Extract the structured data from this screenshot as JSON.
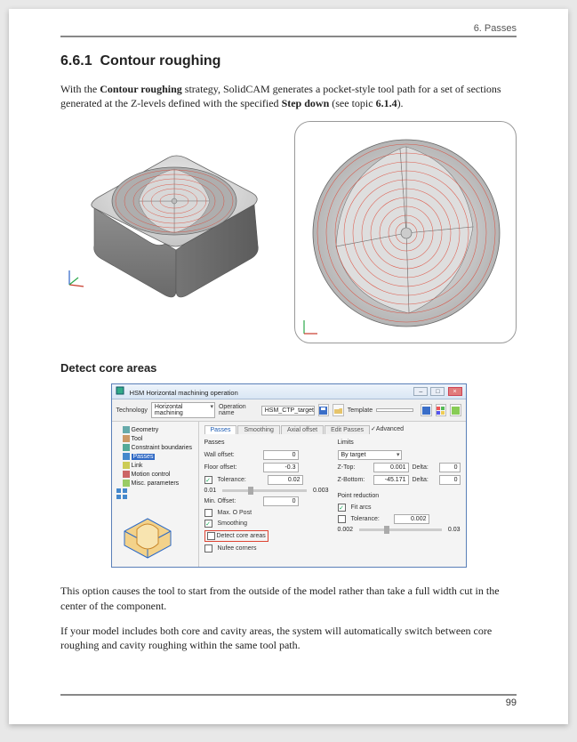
{
  "header": {
    "chapter": "6. Passes"
  },
  "section": {
    "number": "6.6.1",
    "title": "Contour roughing"
  },
  "intro": {
    "pre": "With the ",
    "bold1": "Contour roughing",
    "mid": " strategy, SolidCAM generates a pocket-style tool path for a set of sections generated at the Z-levels defined with the specified ",
    "bold2": "Step down",
    "post1": " (see topic ",
    "bold3": "6.1.4",
    "post2": ")."
  },
  "subheading": "Detect core areas",
  "dialog": {
    "title": "HSM Horizontal machining operation",
    "win_buttons": {
      "min": "–",
      "max": "□",
      "close": "×"
    },
    "toolbar": {
      "technology_label": "Technology",
      "technology_value": "Horizontal machining",
      "opname_label": "Operation name",
      "opname_value": "HSM_CTP_target",
      "template_label": "Template",
      "template_value": ""
    },
    "icons": {
      "save": "save-icon",
      "open": "open-icon",
      "color1": "palette-icon",
      "color2": "swatch-icon"
    },
    "tree": [
      {
        "label": "Geometry",
        "icon": "cube-icon"
      },
      {
        "label": "Tool",
        "icon": "tool-icon"
      },
      {
        "label": "Constraint boundaries",
        "icon": "boundary-icon"
      },
      {
        "label": "Passes",
        "icon": "passes-icon",
        "selected": true
      },
      {
        "label": "Link",
        "icon": "link-icon"
      },
      {
        "label": "Motion control",
        "icon": "motion-icon"
      },
      {
        "label": "Misc. parameters",
        "icon": "misc-icon"
      }
    ],
    "tabs": [
      "Passes",
      "Smoothing",
      "Axial offset",
      "Edit Passes"
    ],
    "advanced": "Advanced",
    "passes_group": "Passes",
    "fields": {
      "wall_offset": {
        "label": "Wall offset:",
        "value": "0"
      },
      "floor_offset": {
        "label": "Floor offset:",
        "value": "-0.3"
      },
      "tolerance": {
        "label": "Tolerance:",
        "value": "0.02",
        "checked": true
      },
      "tol_min": "0.01",
      "tol_max": "0.003",
      "min_offset": {
        "label": "Min. Offset:",
        "value": "0"
      },
      "max_opost": {
        "label": "Max. O Post",
        "checked": false
      },
      "smoothing": {
        "label": "Smoothing",
        "checked": true
      },
      "detect_core": {
        "label": "Detect core areas",
        "checked": false
      },
      "nufee_corners": {
        "label": "Nufee corners",
        "checked": false
      }
    },
    "limits": {
      "group": "Limits",
      "by": "By target",
      "ztop": {
        "label": "Z-Top:",
        "value": "0.001",
        "delta_label": "Delta:",
        "delta": "0"
      },
      "zbottom": {
        "label": "Z-Bottom:",
        "value": "-45.171",
        "delta_label": "Delta:",
        "delta": "0"
      }
    },
    "point_reduction": {
      "group": "Point reduction",
      "fit_arcs": {
        "label": "Fit arcs",
        "checked": true
      },
      "tolerance": {
        "label": "Tolerance:",
        "value": "0.002",
        "checked": false
      },
      "range_min": "0.002",
      "range_max": "0.03"
    }
  },
  "para1": "This option causes the tool to start from the outside of the model rather than take a full width cut in the center of the component.",
  "para2": "If your model includes both core and cavity areas, the system will automatically switch between core roughing and cavity roughing within the same tool path.",
  "page_number": "99"
}
